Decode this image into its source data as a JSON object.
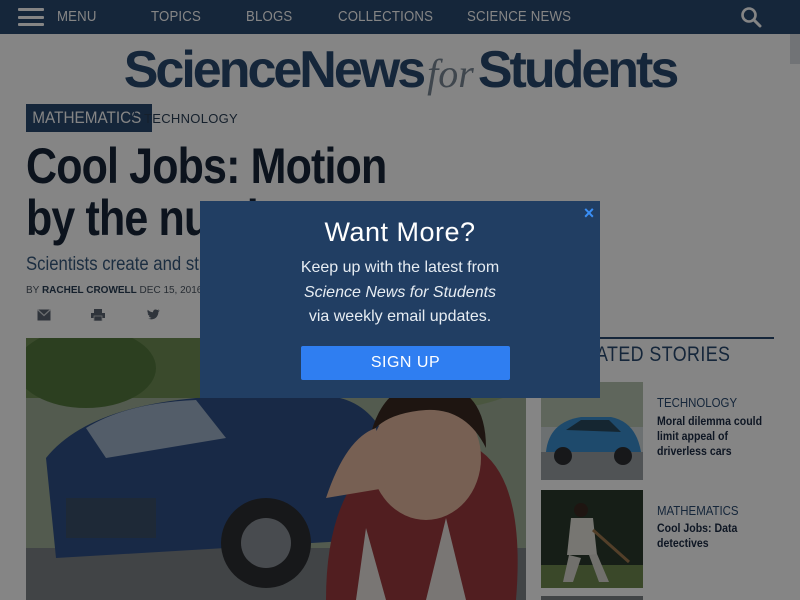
{
  "nav": {
    "menu_label": "MENU",
    "items": [
      "TOPICS",
      "BLOGS",
      "COLLECTIONS",
      "SCIENCE NEWS"
    ]
  },
  "logo": {
    "part1": "ScienceNews",
    "part2": "for",
    "part3": "Students"
  },
  "article": {
    "category_primary": "MATHEMATICS",
    "category_secondary": "TECHNOLOGY",
    "headline": "Cool Jobs: Motion by the numbers",
    "dek": "Scientists create and study",
    "byline_prefix": "BY",
    "author": "RACHEL CROWELL",
    "date": "DEC 15, 2016 — 7:"
  },
  "related": {
    "heading": "RELATED STORIES",
    "items": [
      {
        "category": "TECHNOLOGY",
        "title": "Moral dilemma could limit appeal of driverless cars"
      },
      {
        "category": "MATHEMATICS",
        "title": "Cool Jobs: Data detectives"
      }
    ]
  },
  "modal": {
    "title": "Want More?",
    "line1": "Keep up with the latest from",
    "line2": "Science News for Students",
    "line3": "via weekly email updates.",
    "button": "SIGN UP",
    "close": "×"
  },
  "colors": {
    "navy": "#2a4a70",
    "modal_bg": "#213e63",
    "button": "#2f7ef1",
    "close": "#3a8ef5"
  },
  "icons": [
    "hamburger-icon",
    "search-icon",
    "email-icon",
    "print-icon",
    "twitter-icon",
    "close-icon"
  ]
}
